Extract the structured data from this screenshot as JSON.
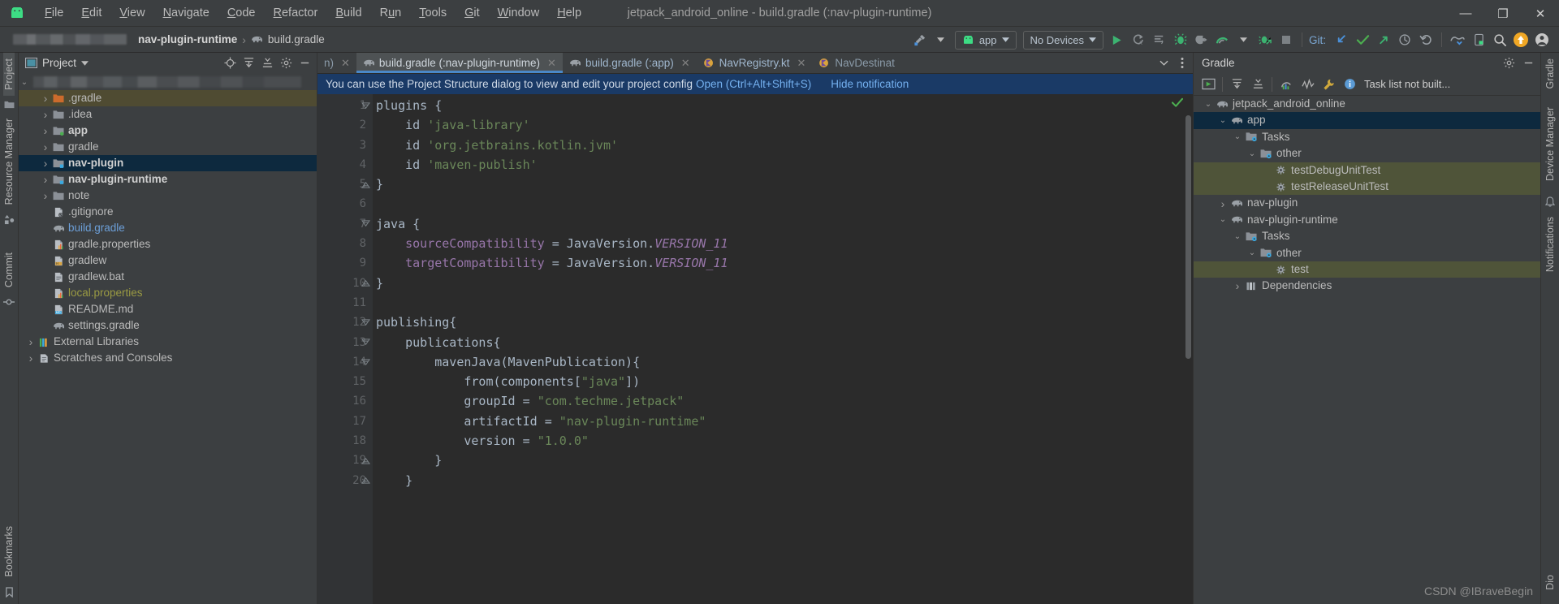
{
  "window": {
    "title": "jetpack_android_online - build.gradle (:nav-plugin-runtime)",
    "minimize": "—",
    "maximize": "❐",
    "close": "✕"
  },
  "menubar": {
    "logo": "android-logo-icon",
    "items": [
      {
        "label": "File",
        "mnemonic": "F"
      },
      {
        "label": "Edit",
        "mnemonic": "E"
      },
      {
        "label": "View",
        "mnemonic": "V"
      },
      {
        "label": "Navigate",
        "mnemonic": "N"
      },
      {
        "label": "Code",
        "mnemonic": "C"
      },
      {
        "label": "Refactor",
        "mnemonic": "R"
      },
      {
        "label": "Build",
        "mnemonic": "B"
      },
      {
        "label": "Run",
        "mnemonic": "u"
      },
      {
        "label": "Tools",
        "mnemonic": "T"
      },
      {
        "label": "Git",
        "mnemonic": "G"
      },
      {
        "label": "Window",
        "mnemonic": "W"
      },
      {
        "label": "Help",
        "mnemonic": "H"
      }
    ]
  },
  "toolbar": {
    "breadcrumb": [
      "nav-plugin-runtime",
      "build.gradle"
    ],
    "breadcrumb_separator": "›",
    "build_hammer": "build-hammer-icon",
    "run_config": "app",
    "device_selector": "No Devices",
    "actions": [
      "run-icon",
      "rerun-icon",
      "apply-changes-icon",
      "debug-icon",
      "attach-debugger-icon",
      "profiler-icon",
      "debug-attach-icon",
      "stop-icon"
    ],
    "git_label": "Git:",
    "git_actions": [
      "update-project-icon",
      "commit-icon",
      "push-icon",
      "history-icon",
      "rollback-icon",
      "device-manager-icon",
      "avd-manager-icon",
      "search-icon",
      "updates-badge-icon",
      "account-icon"
    ]
  },
  "left_strip": {
    "tabs": [
      "Project",
      "Resource Manager",
      "Commit",
      "Bookmarks"
    ]
  },
  "right_strip": {
    "tabs": [
      "Gradle",
      "Device Manager",
      "Notifications",
      "Dio"
    ]
  },
  "project_panel": {
    "title": "Project",
    "header_icons": [
      "locate-icon",
      "expand-all-icon",
      "collapse-all-icon",
      "settings-icon",
      "hide-icon"
    ],
    "tree": [
      {
        "label": "",
        "icon": "blurred-root",
        "indent": 0,
        "arrow": "v",
        "blurred": true,
        "state": "normal"
      },
      {
        "label": ".gradle",
        "icon": "folder-orange-icon",
        "indent": 1,
        "arrow": ">",
        "state": "olive"
      },
      {
        "label": ".idea",
        "icon": "folder-icon",
        "indent": 1,
        "arrow": ">",
        "state": "normal"
      },
      {
        "label": "app",
        "icon": "module-green-icon",
        "indent": 1,
        "arrow": ">",
        "state": "bold"
      },
      {
        "label": "gradle",
        "icon": "folder-icon",
        "indent": 1,
        "arrow": ">",
        "state": "normal"
      },
      {
        "label": "nav-plugin",
        "icon": "module-blue-icon",
        "indent": 1,
        "arrow": ">",
        "state": "selected-bold"
      },
      {
        "label": "nav-plugin-runtime",
        "icon": "module-blue-icon",
        "indent": 1,
        "arrow": ">",
        "state": "bold"
      },
      {
        "label": "note",
        "icon": "folder-icon",
        "indent": 1,
        "arrow": ">",
        "state": "normal"
      },
      {
        "label": ".gitignore",
        "icon": "gitignore-file-icon",
        "indent": 1,
        "arrow": "",
        "state": "normal"
      },
      {
        "label": "build.gradle",
        "icon": "gradle-elephant-icon",
        "indent": 1,
        "arrow": "",
        "state": "blue"
      },
      {
        "label": "gradle.properties",
        "icon": "properties-file-icon",
        "indent": 1,
        "arrow": "",
        "state": "normal"
      },
      {
        "label": "gradlew",
        "icon": "shell-file-icon",
        "indent": 1,
        "arrow": "",
        "state": "normal"
      },
      {
        "label": "gradlew.bat",
        "icon": "bat-file-icon",
        "indent": 1,
        "arrow": "",
        "state": "normal"
      },
      {
        "label": "local.properties",
        "icon": "properties-file-icon",
        "indent": 1,
        "arrow": "",
        "state": "olive-text"
      },
      {
        "label": "README.md",
        "icon": "markdown-file-icon",
        "indent": 1,
        "arrow": "",
        "state": "normal"
      },
      {
        "label": "settings.gradle",
        "icon": "gradle-elephant-icon",
        "indent": 1,
        "arrow": "",
        "state": "normal"
      },
      {
        "label": "External Libraries",
        "icon": "libraries-icon",
        "indent": 0,
        "arrow": ">",
        "state": "normal"
      },
      {
        "label": "Scratches and Consoles",
        "icon": "scratches-icon",
        "indent": 0,
        "arrow": ">",
        "state": "normal"
      }
    ]
  },
  "editor": {
    "tabs": [
      {
        "label": "n)",
        "icon": "gradle-elephant-icon",
        "active": false,
        "partial": true,
        "close": "✕"
      },
      {
        "label": "build.gradle (:nav-plugin-runtime)",
        "icon": "gradle-elephant-icon",
        "active": true,
        "partial": false,
        "close": "✕"
      },
      {
        "label": "build.gradle (:app)",
        "icon": "gradle-elephant-icon",
        "active": false,
        "partial": false,
        "close": "✕"
      },
      {
        "label": "NavRegistry.kt",
        "icon": "kotlin-class-icon",
        "active": false,
        "partial": false,
        "close": "✕"
      },
      {
        "label": "NavDestinat",
        "icon": "kotlin-class-icon",
        "active": false,
        "partial": true,
        "close": ""
      }
    ],
    "tab_overflow": "chevron-down-icon",
    "tab_menu": "more-options-icon",
    "notification": {
      "text": "You can use the Project Structure dialog to view and edit your project config",
      "link": "Open (Ctrl+Alt+Shift+S)",
      "hide": "Hide notification"
    },
    "status_check": "inspection-ok-icon",
    "lines": [
      {
        "n": "1",
        "fold": "minus-top",
        "tokens": [
          {
            "t": "plugins ",
            "c": "ident"
          },
          {
            "t": "{",
            "c": "ident"
          }
        ]
      },
      {
        "n": "2",
        "fold": "",
        "tokens": [
          {
            "t": "    id ",
            "c": "ident"
          },
          {
            "t": "'java-library'",
            "c": "str"
          }
        ]
      },
      {
        "n": "3",
        "fold": "",
        "tokens": [
          {
            "t": "    id ",
            "c": "ident"
          },
          {
            "t": "'org.jetbrains.kotlin.jvm'",
            "c": "str"
          }
        ]
      },
      {
        "n": "4",
        "fold": "",
        "tokens": [
          {
            "t": "    id ",
            "c": "ident"
          },
          {
            "t": "'maven-publish'",
            "c": "str"
          }
        ]
      },
      {
        "n": "5",
        "fold": "minus-bot",
        "tokens": [
          {
            "t": "}",
            "c": "ident"
          }
        ]
      },
      {
        "n": "6",
        "fold": "",
        "tokens": []
      },
      {
        "n": "7",
        "fold": "minus-top",
        "tokens": [
          {
            "t": "java ",
            "c": "ident"
          },
          {
            "t": "{",
            "c": "ident"
          }
        ]
      },
      {
        "n": "8",
        "fold": "",
        "tokens": [
          {
            "t": "    ",
            "c": "ident"
          },
          {
            "t": "sourceCompatibility",
            "c": "prop"
          },
          {
            "t": " = JavaVersion.",
            "c": "ident"
          },
          {
            "t": "VERSION_11",
            "c": "static-it"
          }
        ]
      },
      {
        "n": "9",
        "fold": "",
        "tokens": [
          {
            "t": "    ",
            "c": "ident"
          },
          {
            "t": "targetCompatibility",
            "c": "prop"
          },
          {
            "t": " = JavaVersion.",
            "c": "ident"
          },
          {
            "t": "VERSION_11",
            "c": "static-it"
          }
        ]
      },
      {
        "n": "10",
        "fold": "minus-bot",
        "tokens": [
          {
            "t": "}",
            "c": "ident"
          }
        ]
      },
      {
        "n": "11",
        "fold": "",
        "tokens": []
      },
      {
        "n": "12",
        "fold": "minus-top",
        "tokens": [
          {
            "t": "publishing{",
            "c": "ident"
          }
        ]
      },
      {
        "n": "13",
        "fold": "minus-top",
        "tokens": [
          {
            "t": "    publications{",
            "c": "ident"
          }
        ]
      },
      {
        "n": "14",
        "fold": "minus-top",
        "tokens": [
          {
            "t": "        mavenJava(MavenPublication){",
            "c": "ident"
          }
        ]
      },
      {
        "n": "15",
        "fold": "",
        "tokens": [
          {
            "t": "            from(components[",
            "c": "ident"
          },
          {
            "t": "\"java\"",
            "c": "str"
          },
          {
            "t": "])",
            "c": "ident"
          }
        ]
      },
      {
        "n": "16",
        "fold": "",
        "tokens": [
          {
            "t": "            groupId = ",
            "c": "ident"
          },
          {
            "t": "\"com.techme.jetpack\"",
            "c": "str"
          }
        ]
      },
      {
        "n": "17",
        "fold": "",
        "tokens": [
          {
            "t": "            artifactId = ",
            "c": "ident"
          },
          {
            "t": "\"nav-plugin-runtime\"",
            "c": "str"
          }
        ]
      },
      {
        "n": "18",
        "fold": "",
        "tokens": [
          {
            "t": "            version = ",
            "c": "ident"
          },
          {
            "t": "\"1.0.0\"",
            "c": "str"
          }
        ]
      },
      {
        "n": "19",
        "fold": "minus-bot",
        "tokens": [
          {
            "t": "        }",
            "c": "ident"
          }
        ]
      },
      {
        "n": "20",
        "fold": "minus-bot",
        "tokens": [
          {
            "t": "    }",
            "c": "ident"
          }
        ]
      }
    ]
  },
  "gradle_panel": {
    "title": "Gradle",
    "header_icons": [
      "settings-icon",
      "hide-icon"
    ],
    "toolbar_icons": [
      "execute-task-icon",
      "expand-all-icon",
      "collapse-all-icon",
      "toggle-offline-icon",
      "task-graph-icon",
      "build-tools-icon"
    ],
    "task_status": "Task list not built...",
    "task_status_icon": "info-icon",
    "tree": [
      {
        "label": "jetpack_android_online",
        "icon": "gradle-elephant-icon",
        "indent": 0,
        "arrow": "v",
        "state": "normal"
      },
      {
        "label": "app",
        "icon": "gradle-elephant-icon",
        "indent": 1,
        "arrow": "v",
        "state": "selected-blue"
      },
      {
        "label": "Tasks",
        "icon": "tasks-folder-icon",
        "indent": 2,
        "arrow": "v",
        "state": "normal"
      },
      {
        "label": "other",
        "icon": "tasks-folder-icon",
        "indent": 3,
        "arrow": "v",
        "state": "normal"
      },
      {
        "label": "testDebugUnitTest",
        "icon": "gear-task-icon",
        "indent": 4,
        "arrow": "",
        "state": "olive"
      },
      {
        "label": "testReleaseUnitTest",
        "icon": "gear-task-icon",
        "indent": 4,
        "arrow": "",
        "state": "olive"
      },
      {
        "label": "nav-plugin",
        "icon": "gradle-elephant-icon",
        "indent": 1,
        "arrow": ">",
        "state": "normal"
      },
      {
        "label": "nav-plugin-runtime",
        "icon": "gradle-elephant-icon",
        "indent": 1,
        "arrow": "v",
        "state": "normal"
      },
      {
        "label": "Tasks",
        "icon": "tasks-folder-icon",
        "indent": 2,
        "arrow": "v",
        "state": "normal"
      },
      {
        "label": "other",
        "icon": "tasks-folder-icon",
        "indent": 3,
        "arrow": "v",
        "state": "normal"
      },
      {
        "label": "test",
        "icon": "gear-task-icon",
        "indent": 4,
        "arrow": "",
        "state": "olive"
      },
      {
        "label": "Dependencies",
        "icon": "dependencies-icon",
        "indent": 2,
        "arrow": ">",
        "state": "normal"
      }
    ]
  },
  "watermark": "CSDN @IBraveBegin"
}
